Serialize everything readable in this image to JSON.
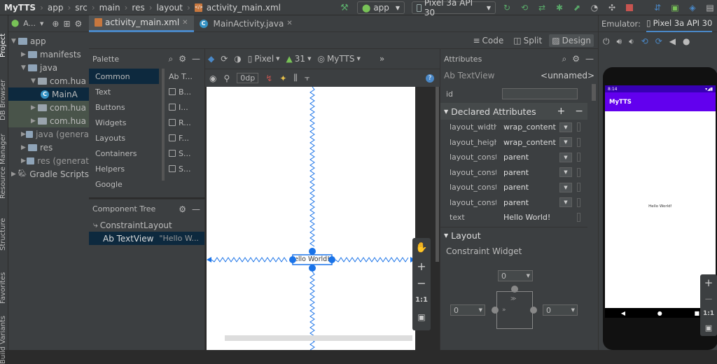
{
  "breadcrumbs": [
    "MyTTS",
    "app",
    "src",
    "main",
    "res",
    "layout",
    "activity_main.xml"
  ],
  "run_config": "app",
  "device": "Pixel 3a API 30",
  "side_tools_left": [
    "Project",
    "DB Browser",
    "Resource Manager",
    "Structure",
    "Favorites",
    "Build Variants"
  ],
  "project_panel": {
    "title": "A...",
    "tree": [
      {
        "label": "app",
        "indent": 0,
        "expanded": true
      },
      {
        "label": "manifests",
        "indent": 1,
        "expanded": false
      },
      {
        "label": "java",
        "indent": 1,
        "expanded": true
      },
      {
        "label": "com.hua",
        "indent": 2,
        "expanded": true
      },
      {
        "label": "MainA",
        "indent": 3,
        "kind": "class"
      },
      {
        "label": "com.hua",
        "indent": 2,
        "expanded": false,
        "tone": "green"
      },
      {
        "label": "com.hua",
        "indent": 2,
        "expanded": false,
        "tone": "green"
      },
      {
        "label": "java (genera",
        "indent": 1,
        "expanded": false
      },
      {
        "label": "res",
        "indent": 1,
        "expanded": false
      },
      {
        "label": "res (generat",
        "indent": 1,
        "expanded": false
      },
      {
        "label": "Gradle Scripts",
        "indent": 0,
        "expanded": false
      }
    ]
  },
  "editor_tabs": [
    {
      "label": "activity_main.xml",
      "active": true
    },
    {
      "label": "MainActivity.java",
      "active": false
    }
  ],
  "view_modes": [
    "Code",
    "Split",
    "Design"
  ],
  "active_view_mode": "Design",
  "palette": {
    "title": "Palette",
    "categories": [
      "Common",
      "Text",
      "Buttons",
      "Widgets",
      "Layouts",
      "Containers",
      "Helpers",
      "Google"
    ],
    "selected": "Common",
    "items": [
      "Ab T...",
      "B...",
      "I...",
      "R...",
      "F...",
      "S...",
      "S..."
    ]
  },
  "component_tree": {
    "title": "Component Tree",
    "root": "ConstraintLayout",
    "child": {
      "type": "Ab TextView",
      "text": "\"Hello W..."
    }
  },
  "design_toolbar": {
    "device": "Pixel",
    "api": "31",
    "theme": "MyTTS",
    "margin": "0dp"
  },
  "canvas_widget_text": "Hello World!",
  "attributes": {
    "title": "Attributes",
    "widget_type": "Ab TextView",
    "widget_name": "<unnamed>",
    "id_label": "id",
    "declared_title": "Declared Attributes",
    "declared": [
      {
        "name": "layout_width",
        "value": "wrap_content"
      },
      {
        "name": "layout_height",
        "value": "wrap_content"
      },
      {
        "name": "layout_constra...",
        "value": "parent"
      },
      {
        "name": "layout_constra...",
        "value": "parent"
      },
      {
        "name": "layout_constra...",
        "value": "parent"
      },
      {
        "name": "layout_constra...",
        "value": "parent"
      },
      {
        "name": "text",
        "value": "Hello World!"
      }
    ],
    "layout_title": "Layout",
    "constraint_widget": "Constraint Widget",
    "margins": {
      "top": "0",
      "left": "0",
      "right": "0"
    }
  },
  "emulator": {
    "label": "Emulator:",
    "device_tab": "Pixel 3a API 30",
    "status_time": "8:14",
    "app_title": "MyTTS",
    "content": "Hello World!"
  },
  "canvas_zoom": {
    "fit": "1:1"
  },
  "colors": {
    "accent": "#4a88c7",
    "blueprint": "#1a73e8",
    "purple_appbar": "#6200ee",
    "purple_status": "#3700b3"
  }
}
